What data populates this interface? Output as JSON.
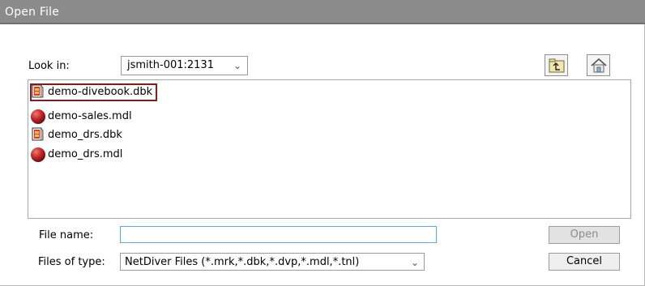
{
  "window": {
    "title": "Open File"
  },
  "lookin": {
    "label": "Look in:",
    "value": "jsmith-001:2131",
    "chevron_icon": "chevron-down-icon"
  },
  "toolbar": {
    "up_icon": "up-folder-icon",
    "home_icon": "home-icon"
  },
  "files": [
    {
      "name": "demo-divebook.dbk",
      "icon": "divebook-icon",
      "selected": true
    },
    {
      "name": "demo-sales.mdl",
      "icon": "model-ball-icon",
      "selected": false
    },
    {
      "name": "demo_drs.dbk",
      "icon": "divebook-icon",
      "selected": false
    },
    {
      "name": "demo_drs.mdl",
      "icon": "model-ball-icon",
      "selected": false
    }
  ],
  "filename": {
    "label": "File name:",
    "value": "",
    "placeholder": ""
  },
  "filetype": {
    "label": "Files of type:",
    "value": "NetDiver Files (*.mrk,*.dbk,*.dvp,*.mdl,*.tnl)"
  },
  "buttons": {
    "open": "Open",
    "cancel": "Cancel"
  },
  "colors": {
    "titlebar": "#8b8b8b",
    "selection_border": "#8b1a1a",
    "input_focus": "#6aa3d8",
    "ball_icon": "#c0282b"
  }
}
